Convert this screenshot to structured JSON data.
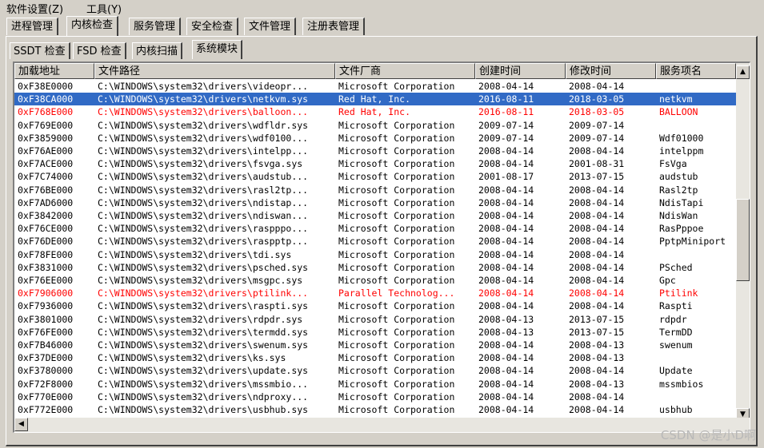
{
  "menu": [
    "软件设置(Z)",
    "工具(Y)"
  ],
  "main_tabs": [
    "进程管理",
    "内核检查",
    "服务管理",
    "安全检查",
    "文件管理",
    "注册表管理"
  ],
  "sub_tabs": [
    "SSDT 检查",
    "FSD 检查",
    "内核扫描",
    "系统模块"
  ],
  "columns": [
    "加载地址",
    "文件路径",
    "文件厂商",
    "创建时间",
    "修改时间",
    "服务项名"
  ],
  "rows": [
    {
      "addr": "0xF38E0000",
      "path": "C:\\WINDOWS\\system32\\drivers\\videopr...",
      "vendor": "Microsoft Corporation",
      "created": "2008-04-14",
      "modified": "2008-04-14",
      "service": ""
    },
    {
      "addr": "0xF38CA000",
      "path": "C:\\WINDOWS\\system32\\drivers\\netkvm.sys",
      "vendor": "Red Hat, Inc.",
      "created": "2016-08-11",
      "modified": "2018-03-05",
      "service": "netkvm",
      "selected": true
    },
    {
      "addr": "0xF768E000",
      "path": "C:\\WINDOWS\\system32\\drivers\\balloon...",
      "vendor": "Red Hat, Inc.",
      "created": "2016-08-11",
      "modified": "2018-03-05",
      "service": "BALLOON",
      "red": true
    },
    {
      "addr": "0xF769E000",
      "path": "C:\\WINDOWS\\system32\\drivers\\wdfldr.sys",
      "vendor": "Microsoft Corporation",
      "created": "2009-07-14",
      "modified": "2009-07-14",
      "service": ""
    },
    {
      "addr": "0xF3859000",
      "path": "C:\\WINDOWS\\system32\\drivers\\wdf0100...",
      "vendor": "Microsoft Corporation",
      "created": "2009-07-14",
      "modified": "2009-07-14",
      "service": "Wdf01000"
    },
    {
      "addr": "0xF76AE000",
      "path": "C:\\WINDOWS\\system32\\drivers\\intelpp...",
      "vendor": "Microsoft Corporation",
      "created": "2008-04-14",
      "modified": "2008-04-14",
      "service": "intelppm"
    },
    {
      "addr": "0xF7ACE000",
      "path": "C:\\WINDOWS\\system32\\drivers\\fsvga.sys",
      "vendor": "Microsoft Corporation",
      "created": "2008-04-14",
      "modified": "2001-08-31",
      "service": "FsVga"
    },
    {
      "addr": "0xF7C74000",
      "path": "C:\\WINDOWS\\system32\\drivers\\audstub...",
      "vendor": "Microsoft Corporation",
      "created": "2001-08-17",
      "modified": "2013-07-15",
      "service": "audstub"
    },
    {
      "addr": "0xF76BE000",
      "path": "C:\\WINDOWS\\system32\\drivers\\rasl2tp...",
      "vendor": "Microsoft Corporation",
      "created": "2008-04-14",
      "modified": "2008-04-14",
      "service": "Rasl2tp"
    },
    {
      "addr": "0xF7AD6000",
      "path": "C:\\WINDOWS\\system32\\drivers\\ndistap...",
      "vendor": "Microsoft Corporation",
      "created": "2008-04-14",
      "modified": "2008-04-14",
      "service": "NdisTapi"
    },
    {
      "addr": "0xF3842000",
      "path": "C:\\WINDOWS\\system32\\drivers\\ndiswan...",
      "vendor": "Microsoft Corporation",
      "created": "2008-04-14",
      "modified": "2008-04-14",
      "service": "NdisWan"
    },
    {
      "addr": "0xF76CE000",
      "path": "C:\\WINDOWS\\system32\\drivers\\raspppo...",
      "vendor": "Microsoft Corporation",
      "created": "2008-04-14",
      "modified": "2008-04-14",
      "service": "RasPppoe"
    },
    {
      "addr": "0xF76DE000",
      "path": "C:\\WINDOWS\\system32\\drivers\\raspptp...",
      "vendor": "Microsoft Corporation",
      "created": "2008-04-14",
      "modified": "2008-04-14",
      "service": "PptpMiniport"
    },
    {
      "addr": "0xF78FE000",
      "path": "C:\\WINDOWS\\system32\\drivers\\tdi.sys",
      "vendor": "Microsoft Corporation",
      "created": "2008-04-14",
      "modified": "2008-04-14",
      "service": ""
    },
    {
      "addr": "0xF3831000",
      "path": "C:\\WINDOWS\\system32\\drivers\\psched.sys",
      "vendor": "Microsoft Corporation",
      "created": "2008-04-14",
      "modified": "2008-04-14",
      "service": "PSched"
    },
    {
      "addr": "0xF76EE000",
      "path": "C:\\WINDOWS\\system32\\drivers\\msgpc.sys",
      "vendor": "Microsoft Corporation",
      "created": "2008-04-14",
      "modified": "2008-04-14",
      "service": "Gpc"
    },
    {
      "addr": "0xF7906000",
      "path": "C:\\WINDOWS\\system32\\drivers\\ptilink...",
      "vendor": "Parallel Technolog...",
      "created": "2008-04-14",
      "modified": "2008-04-14",
      "service": "Ptilink",
      "red": true
    },
    {
      "addr": "0xF7936000",
      "path": "C:\\WINDOWS\\system32\\drivers\\raspti.sys",
      "vendor": "Microsoft Corporation",
      "created": "2008-04-14",
      "modified": "2008-04-14",
      "service": "Raspti"
    },
    {
      "addr": "0xF3801000",
      "path": "C:\\WINDOWS\\system32\\drivers\\rdpdr.sys",
      "vendor": "Microsoft Corporation",
      "created": "2008-04-13",
      "modified": "2013-07-15",
      "service": "rdpdr"
    },
    {
      "addr": "0xF76FE000",
      "path": "C:\\WINDOWS\\system32\\drivers\\termdd.sys",
      "vendor": "Microsoft Corporation",
      "created": "2008-04-13",
      "modified": "2013-07-15",
      "service": "TermDD"
    },
    {
      "addr": "0xF7B46000",
      "path": "C:\\WINDOWS\\system32\\drivers\\swenum.sys",
      "vendor": "Microsoft Corporation",
      "created": "2008-04-14",
      "modified": "2008-04-13",
      "service": "swenum"
    },
    {
      "addr": "0xF37DE000",
      "path": "C:\\WINDOWS\\system32\\drivers\\ks.sys",
      "vendor": "Microsoft Corporation",
      "created": "2008-04-14",
      "modified": "2008-04-13",
      "service": ""
    },
    {
      "addr": "0xF3780000",
      "path": "C:\\WINDOWS\\system32\\drivers\\update.sys",
      "vendor": "Microsoft Corporation",
      "created": "2008-04-14",
      "modified": "2008-04-14",
      "service": "Update"
    },
    {
      "addr": "0xF72F8000",
      "path": "C:\\WINDOWS\\system32\\drivers\\mssmbio...",
      "vendor": "Microsoft Corporation",
      "created": "2008-04-14",
      "modified": "2008-04-13",
      "service": "mssmbios"
    },
    {
      "addr": "0xF770E000",
      "path": "C:\\WINDOWS\\system32\\drivers\\ndproxy...",
      "vendor": "Microsoft Corporation",
      "created": "2008-04-14",
      "modified": "2008-04-14",
      "service": ""
    },
    {
      "addr": "0xF772E000",
      "path": "C:\\WINDOWS\\system32\\drivers\\usbhub.sys",
      "vendor": "Microsoft Corporation",
      "created": "2008-04-14",
      "modified": "2008-04-14",
      "service": "usbhub"
    }
  ],
  "watermark": "CSDN @是小D啊",
  "colors": {
    "selected_bg": "#316ac5",
    "highlight_text": "#ff0000"
  }
}
